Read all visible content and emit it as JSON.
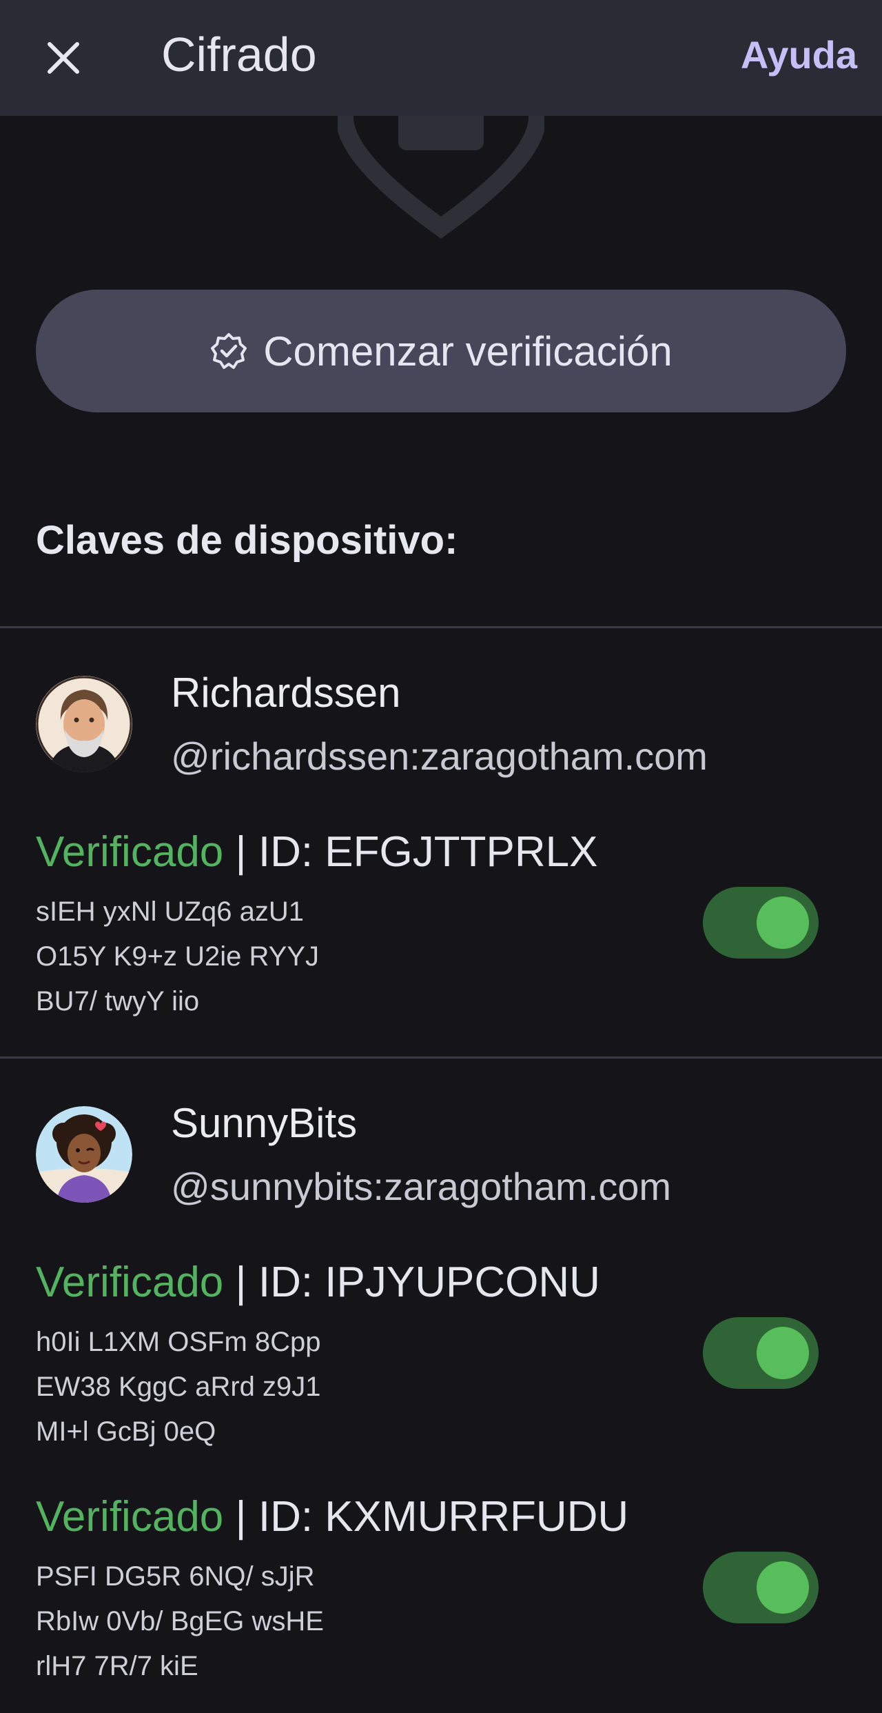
{
  "appbar": {
    "close_icon": "close-icon",
    "title": "Cifrado",
    "help_label": "Ayuda"
  },
  "illustration": {
    "icon": "shield-icon"
  },
  "verify_button": {
    "icon": "verified-badge-icon",
    "label": "Comenzar verificación"
  },
  "section_title": "Claves de dispositivo:",
  "users": [
    {
      "name": "Richardssen",
      "handle": "@richardssen:zaragotham.com",
      "avatar": "avatar-richardssen",
      "keys": [
        {
          "status": "Verificado",
          "id_text": " | ID: EFGJTTPRLX",
          "fingerprint": [
            "sIEH yxNl UZq6 azU1",
            "O15Y K9+z U2ie RYYJ",
            "BU7/ twyY iio"
          ],
          "enabled": true
        }
      ]
    },
    {
      "name": "SunnyBits",
      "handle": "@sunnybits:zaragotham.com",
      "avatar": "avatar-sunnybits",
      "keys": [
        {
          "status": "Verificado",
          "id_text": " | ID: IPJYUPCONU",
          "fingerprint": [
            "h0Ii L1XM OSFm 8Cpp",
            "EW38 KggC aRrd z9J1",
            "MI+l GcBj 0eQ"
          ],
          "enabled": true
        },
        {
          "status": "Verificado",
          "id_text": " | ID: KXMURRFUDU",
          "fingerprint": [
            "PSFI DG5R 6NQ/ sJjR",
            "RbIw 0Vb/ BgEG wsHE",
            "rlH7 7R/7 kiE"
          ],
          "enabled": true
        }
      ]
    }
  ]
}
